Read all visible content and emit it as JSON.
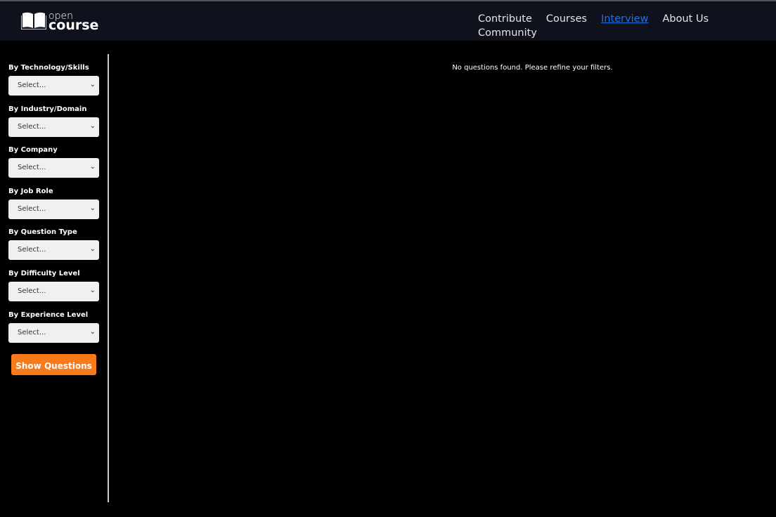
{
  "header": {
    "logo_top": "open",
    "logo_bottom": "course",
    "nav": [
      {
        "label": "Contribute"
      },
      {
        "label": "Courses"
      },
      {
        "label": "Interview",
        "active": true
      },
      {
        "label": "About Us"
      },
      {
        "label": "Community"
      }
    ]
  },
  "filters": [
    {
      "label": "By Technology/Skills",
      "value": "Select..."
    },
    {
      "label": "By Industry/Domain",
      "value": "Select..."
    },
    {
      "label": "By Company",
      "value": "Select..."
    },
    {
      "label": "By Job Role",
      "value": "Select..."
    },
    {
      "label": "By Question Type",
      "value": "Select..."
    },
    {
      "label": "By Difficulty Level",
      "value": "Select..."
    },
    {
      "label": "By Experience Level",
      "value": "Select..."
    }
  ],
  "show_button": "Show Questions",
  "message": "No questions found. Please refine your filters.",
  "colors": {
    "accent": "#f97a1b",
    "active_link": "#1a73e8",
    "header_bg": "#0f111c"
  }
}
